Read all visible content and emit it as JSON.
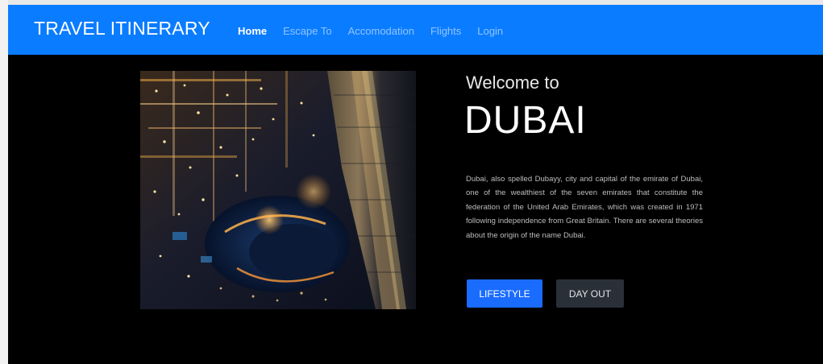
{
  "navbar": {
    "brand": "TRAVEL ITINERARY",
    "links": [
      {
        "label": "Home",
        "active": true
      },
      {
        "label": "Escape To",
        "active": false
      },
      {
        "label": "Accomodation",
        "active": false
      },
      {
        "label": "Flights",
        "active": false
      },
      {
        "label": "Login",
        "active": false
      }
    ]
  },
  "hero": {
    "image_icon": "city-night-aerial-image",
    "welcome": "Welcome to",
    "city": "DUBAI",
    "description": "Dubai, also spelled Dubayy, city and capital of the emirate of Dubai, one of the wealthiest of the seven emirates that constitute the federation of the United Arab Emirates, which was created in 1971 following independence from Great Britain. There are several theories about the origin of the name Dubai.",
    "buttons": {
      "primary": "LIFESTYLE",
      "secondary": "DAY OUT"
    }
  },
  "colors": {
    "navbar": "#0a7cff",
    "background": "#000000",
    "primary_button": "#1a6cff",
    "secondary_button": "#2a3038"
  }
}
